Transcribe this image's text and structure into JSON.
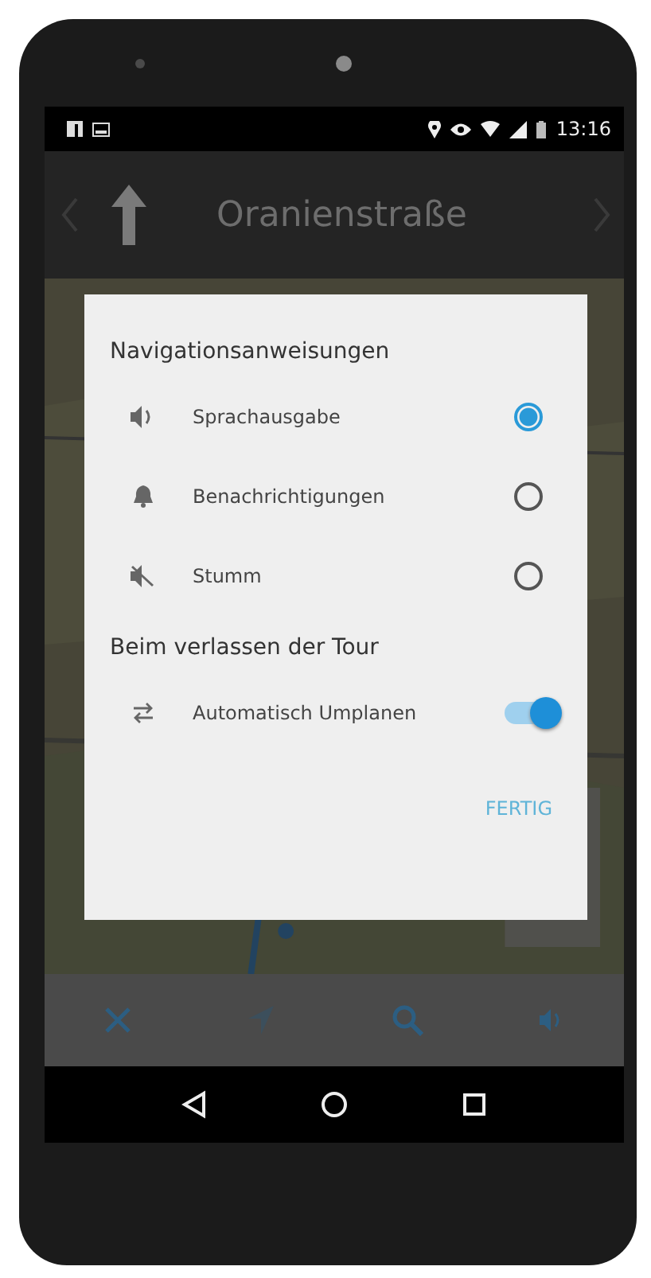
{
  "status_bar": {
    "time": "13:16"
  },
  "header": {
    "street": "Oranienstraße"
  },
  "dialog": {
    "sections": [
      {
        "title": "Navigationsanweisungen",
        "options": [
          {
            "kind": "radio",
            "label": "Sprachausgabe",
            "selected": true
          },
          {
            "kind": "radio",
            "label": "Benachrichtigungen",
            "selected": false
          },
          {
            "kind": "radio",
            "label": "Stumm",
            "selected": false
          }
        ]
      },
      {
        "title": "Beim verlassen der Tour",
        "options": [
          {
            "kind": "switch",
            "label": "Automatisch Umplanen",
            "on": true
          }
        ]
      }
    ],
    "button": "FERTIG"
  }
}
